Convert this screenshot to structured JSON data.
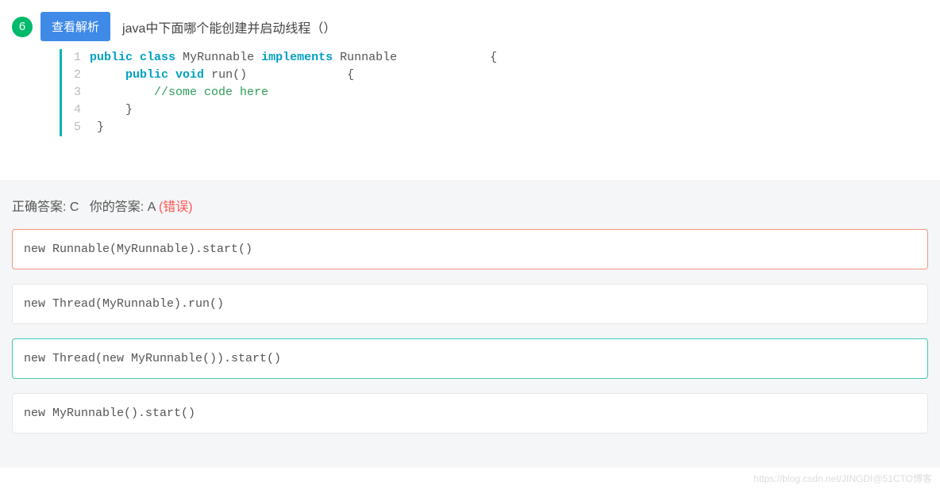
{
  "question": {
    "number": "6",
    "view_button": "查看解析",
    "title": "java中下面哪个能创建并启动线程（）",
    "code_lines": [
      "public class MyRunnable implements Runnable             {",
      "     public void run()              {",
      "         //some code here",
      "     }",
      " }"
    ]
  },
  "answers": {
    "correct_label": "正确答案: C",
    "your_label": "你的答案: A",
    "wrong_tag": "(错误)"
  },
  "options": [
    {
      "text": "new Runnable(MyRunnable).start()",
      "state": "selected-wrong"
    },
    {
      "text": "new Thread(MyRunnable).run()",
      "state": ""
    },
    {
      "text": "new Thread(new MyRunnable()).start()",
      "state": "correct"
    },
    {
      "text": "new MyRunnable().start()",
      "state": ""
    }
  ],
  "watermark": "https://blog.csdn.net/JINGDI@51CTO博客",
  "colors": {
    "badge_green": "#00b96b",
    "button_blue": "#3f8ae7",
    "code_border": "#00b5ad",
    "correct_border": "#46c9b3",
    "wrong_border": "#f3957d",
    "wrong_text": "#f55"
  }
}
